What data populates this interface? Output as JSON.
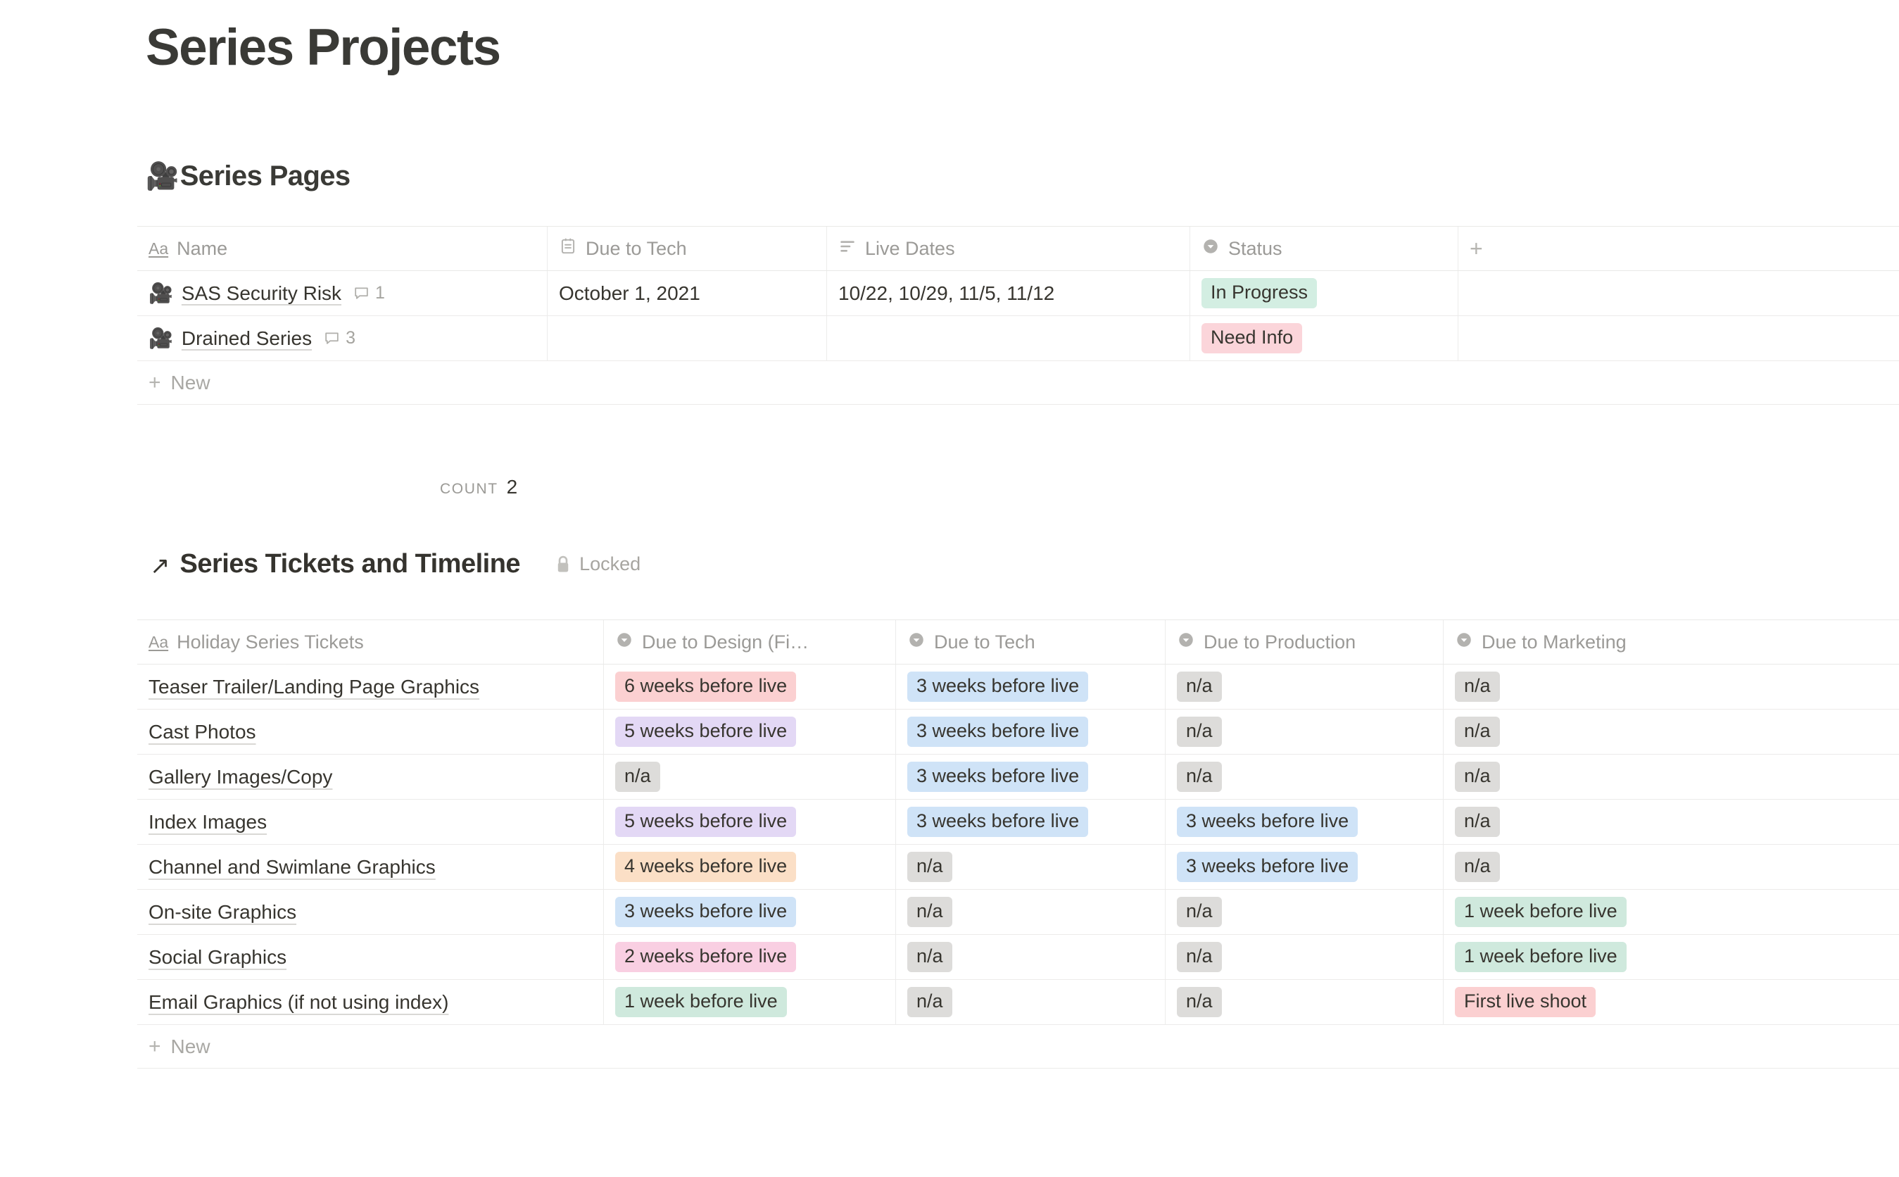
{
  "page": {
    "title": "Series Projects"
  },
  "series_pages": {
    "emoji": "🎥",
    "heading": "Series Pages",
    "columns": [
      {
        "label": "Name",
        "icon": "title-text-icon"
      },
      {
        "label": "Due to Tech",
        "icon": "calendar-date-icon"
      },
      {
        "label": "Live Dates",
        "icon": "multiline-text-icon"
      },
      {
        "label": "Status",
        "icon": "select-chevron-icon"
      },
      {
        "label": "",
        "icon": "plus-icon"
      }
    ],
    "rows": [
      {
        "emoji": "🎥",
        "name": "SAS Security Risk",
        "comments": "1",
        "due_to_tech": "October 1, 2021",
        "live_dates": "10/22, 10/29, 11/5, 11/12",
        "status": "In Progress",
        "status_color": "#d3eee2"
      },
      {
        "emoji": "🎥",
        "name": "Drained Series",
        "comments": "3",
        "due_to_tech": "",
        "live_dates": "",
        "status": "Need Info",
        "status_color": "#fbd5da"
      }
    ],
    "new_row_label": "New",
    "footer": {
      "count_label": "COUNT",
      "count_value": "2"
    }
  },
  "series_tickets": {
    "arrow": "↗",
    "heading": "Series Tickets and Timeline",
    "locked_label": "Locked",
    "columns": [
      {
        "label": "Holiday Series Tickets",
        "icon": "title-text-icon"
      },
      {
        "label": "Due to Design (Fi…",
        "icon": "select-chevron-icon"
      },
      {
        "label": "Due to Tech",
        "icon": "select-chevron-icon"
      },
      {
        "label": "Due to Production",
        "icon": "select-chevron-icon"
      },
      {
        "label": "Due to Marketing",
        "icon": "select-chevron-icon"
      }
    ],
    "rows": [
      {
        "name": "Teaser Trailer/Landing Page Graphics",
        "design": {
          "text": "6 weeks before live",
          "color": "#fbd0d1"
        },
        "tech": {
          "text": "3 weeks before live",
          "color": "#cfe3f7"
        },
        "production": {
          "text": "n/a",
          "color": "#dddcda"
        },
        "marketing": {
          "text": "n/a",
          "color": "#dddcda"
        }
      },
      {
        "name": "Cast Photos",
        "design": {
          "text": "5 weeks before live",
          "color": "#e3d8f5"
        },
        "tech": {
          "text": "3 weeks before live",
          "color": "#cfe3f7"
        },
        "production": {
          "text": "n/a",
          "color": "#dddcda"
        },
        "marketing": {
          "text": "n/a",
          "color": "#dddcda"
        }
      },
      {
        "name": "Gallery Images/Copy",
        "design": {
          "text": "n/a",
          "color": "#dddcda"
        },
        "tech": {
          "text": "3 weeks before live",
          "color": "#cfe3f7"
        },
        "production": {
          "text": "n/a",
          "color": "#dddcda"
        },
        "marketing": {
          "text": "n/a",
          "color": "#dddcda"
        }
      },
      {
        "name": "Index Images",
        "design": {
          "text": "5 weeks before live",
          "color": "#e3d8f5"
        },
        "tech": {
          "text": "3 weeks before live",
          "color": "#cfe3f7"
        },
        "production": {
          "text": "3 weeks before live",
          "color": "#cfe3f7"
        },
        "marketing": {
          "text": "n/a",
          "color": "#dddcda"
        }
      },
      {
        "name": "Channel and Swimlane Graphics",
        "design": {
          "text": "4 weeks before live",
          "color": "#fbdfc6"
        },
        "tech": {
          "text": "n/a",
          "color": "#dddcda"
        },
        "production": {
          "text": "3 weeks before live",
          "color": "#cfe3f7"
        },
        "marketing": {
          "text": "n/a",
          "color": "#dddcda"
        }
      },
      {
        "name": "On-site Graphics",
        "design": {
          "text": "3 weeks before live",
          "color": "#cfe3f7"
        },
        "tech": {
          "text": "n/a",
          "color": "#dddcda"
        },
        "production": {
          "text": "n/a",
          "color": "#dddcda"
        },
        "marketing": {
          "text": "1 week before live",
          "color": "#cfe9dd"
        }
      },
      {
        "name": "Social Graphics",
        "design": {
          "text": "2 weeks before live",
          "color": "#f9cfe2"
        },
        "tech": {
          "text": "n/a",
          "color": "#dddcda"
        },
        "production": {
          "text": "n/a",
          "color": "#dddcda"
        },
        "marketing": {
          "text": "1 week before live",
          "color": "#cfe9dd"
        }
      },
      {
        "name": "Email Graphics (if not using index)",
        "design": {
          "text": "1 week before live",
          "color": "#cfe9dd"
        },
        "tech": {
          "text": "n/a",
          "color": "#dddcda"
        },
        "production": {
          "text": "n/a",
          "color": "#dddcda"
        },
        "marketing": {
          "text": "First live shoot",
          "color": "#fbd0d1"
        }
      }
    ],
    "new_row_label": "New"
  }
}
